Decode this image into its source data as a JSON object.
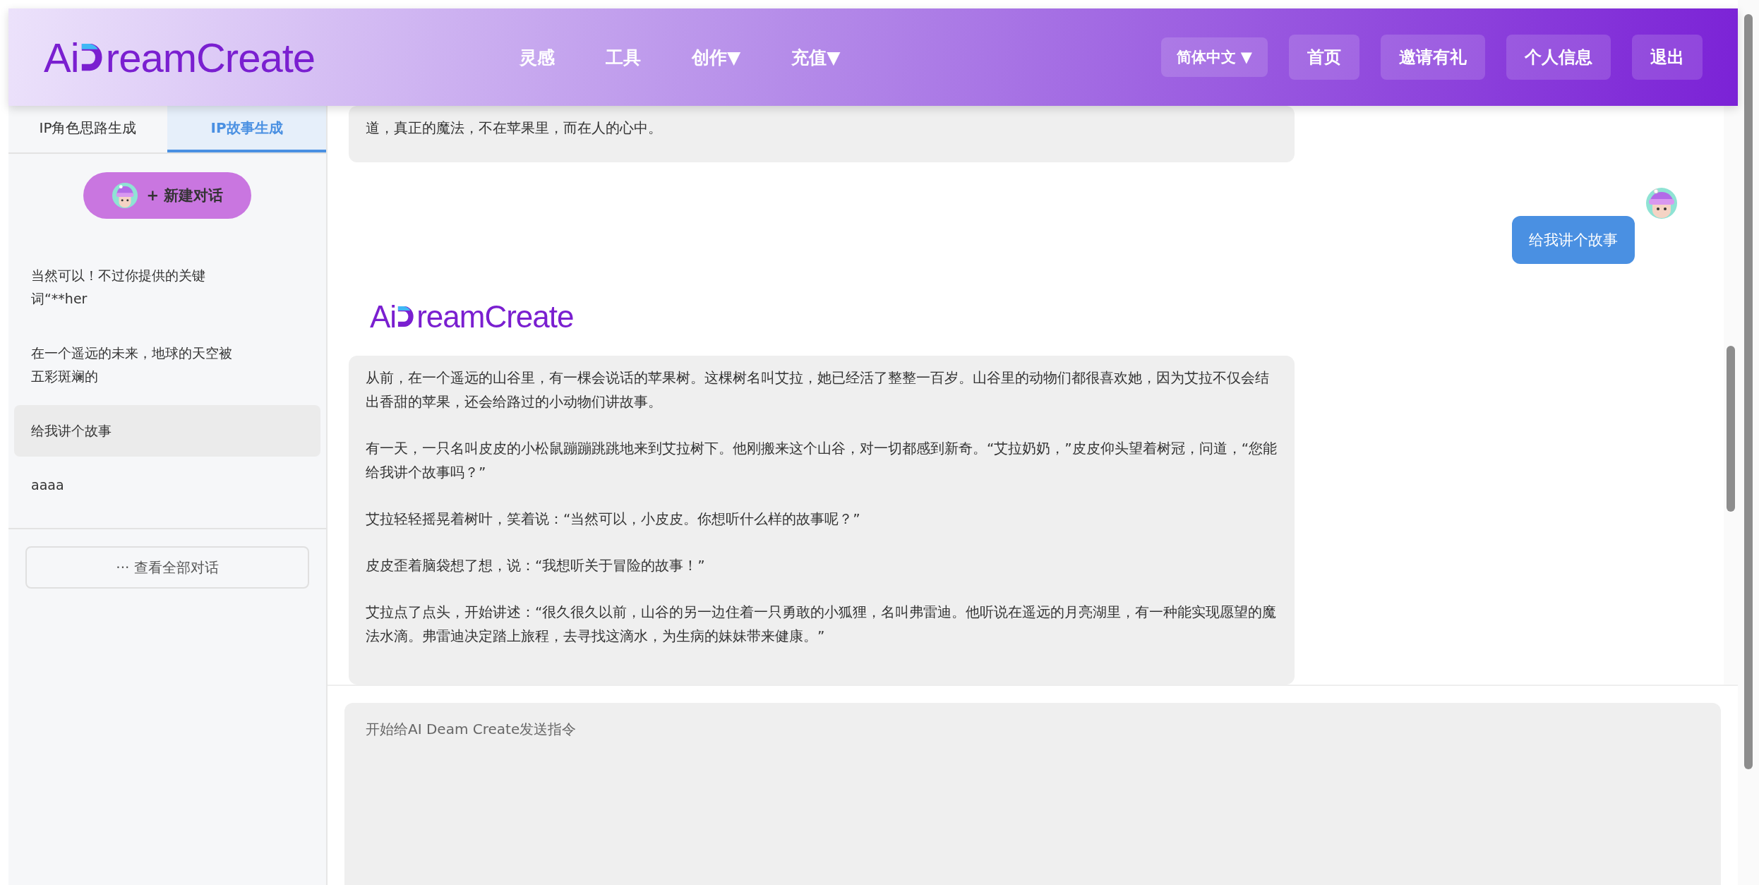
{
  "header": {
    "logo": {
      "lead": "Ai",
      "tail": "reamCreate"
    },
    "nav": [
      {
        "label": "灵感"
      },
      {
        "label": "工具"
      },
      {
        "label": "创作",
        "caret": "▼"
      },
      {
        "label": "充值",
        "caret": "▼"
      }
    ],
    "language": {
      "label": "简体中文",
      "caret": "▼"
    },
    "buttons": [
      "首页",
      "邀请有礼",
      "个人信息",
      "退出"
    ]
  },
  "sidebar": {
    "tabs": [
      {
        "label": "IP角色思路生成",
        "selected": false
      },
      {
        "label": "IP故事生成",
        "selected": true
      }
    ],
    "new_chat": "+ 新建对话",
    "items": [
      {
        "label": "当然可以！不过你提供的关键词“**her",
        "selected": false
      },
      {
        "label": "在一个遥远的未来，地球的天空被五彩斑斓的",
        "selected": false
      },
      {
        "label": "给我讲个故事",
        "selected": true
      },
      {
        "label": "aaaa",
        "selected": false
      }
    ],
    "view_all": "··· 查看全部对话"
  },
  "messages": [
    {
      "kind": "bot",
      "paragraphs": [
        "道，真正的魔法，不在苹果里，而在人的心中。"
      ]
    },
    {
      "kind": "user",
      "text": "给我讲个故事"
    },
    {
      "kind": "bot",
      "logo": {
        "lead": "Ai",
        "tail": "reamCreate"
      },
      "paragraphs": [
        "从前，在一个遥远的山谷里，有一棵会说话的苹果树。这棵树名叫艾拉，她已经活了整整一百岁。山谷里的动物们都很喜欢她，因为艾拉不仅会结出香甜的苹果，还会给路过的小动物们讲故事。",
        "有一天，一只名叫皮皮的小松鼠蹦蹦跳跳地来到艾拉树下。他刚搬来这个山谷，对一切都感到新奇。“艾拉奶奶，”皮皮仰头望着树冠，问道，“您能给我讲个故事吗？”",
        "艾拉轻轻摇晃着树叶，笑着说：“当然可以，小皮皮。你想听什么样的故事呢？”",
        "皮皮歪着脑袋想了想，说：“我想听关于冒险的故事！”",
        "艾拉点了点头，开始讲述：“很久很久以前，山谷的另一边住着一只勇敢的小狐狸，名叫弗雷迪。他听说在遥远的月亮湖里，有一种能实现愿望的魔法水滴。弗雷迪决定踏上旅程，去寻找这滴水，为生病的妹妹带来健康。”"
      ]
    }
  ],
  "composer": {
    "placeholder": "开始给AI Deam Create发送指令"
  }
}
